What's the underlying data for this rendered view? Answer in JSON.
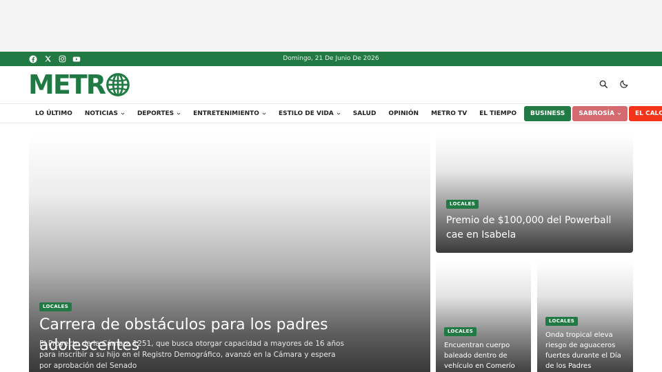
{
  "topbar": {
    "date": "Domingo, 21 De Junio De 2026",
    "socials": [
      {
        "icon": "facebook-icon"
      },
      {
        "icon": "x-twitter-icon"
      },
      {
        "icon": "instagram-icon"
      },
      {
        "icon": "youtube-icon"
      }
    ]
  },
  "header": {
    "logo_text": "METR",
    "logo_icon": "globe-icon"
  },
  "nav": {
    "items": [
      {
        "label": "LO ÚLTIMO"
      },
      {
        "label": "NOTICIAS"
      },
      {
        "label": "DEPORTES"
      },
      {
        "label": "ENTRETENIMIENTO"
      },
      {
        "label": "ESTILO DE VIDA"
      },
      {
        "label": "SALUD"
      },
      {
        "label": "OPINIÓN"
      },
      {
        "label": "METRO TV"
      },
      {
        "label": "EL TIEMPO"
      },
      {
        "label": "BUSINESS"
      },
      {
        "label": "SABROSÍA"
      },
      {
        "label": "EL CALCE"
      }
    ]
  },
  "articles": {
    "main": {
      "category": "LOCALES",
      "title": "Carrera de obstáculos para los padres adolescentes",
      "excerpt": "El Proyecto de la Cámara 1251, que busca otorgar capacidad a mayores de 16 años para inscribir a su hijo en el Registro Demográfico, avanzó en la Cámara y espera por aprobación del Senado"
    },
    "side1": {
      "category": "LOCALES",
      "title": "Premio de $100,000 del Powerball cae en Isabela"
    },
    "side2": {
      "category": "LOCALES",
      "title": "Encuentran cuerpo baleado dentro de vehículo en Comerío"
    },
    "side3": {
      "category": "LOCALES",
      "title": "Onda tropical eleva riesgo de aguaceros fuertes durante el Día de los Padres"
    }
  },
  "colors": {
    "brand_green": "#217a43",
    "sabrosia": "#d46a6f",
    "calce": "#f3341a"
  }
}
